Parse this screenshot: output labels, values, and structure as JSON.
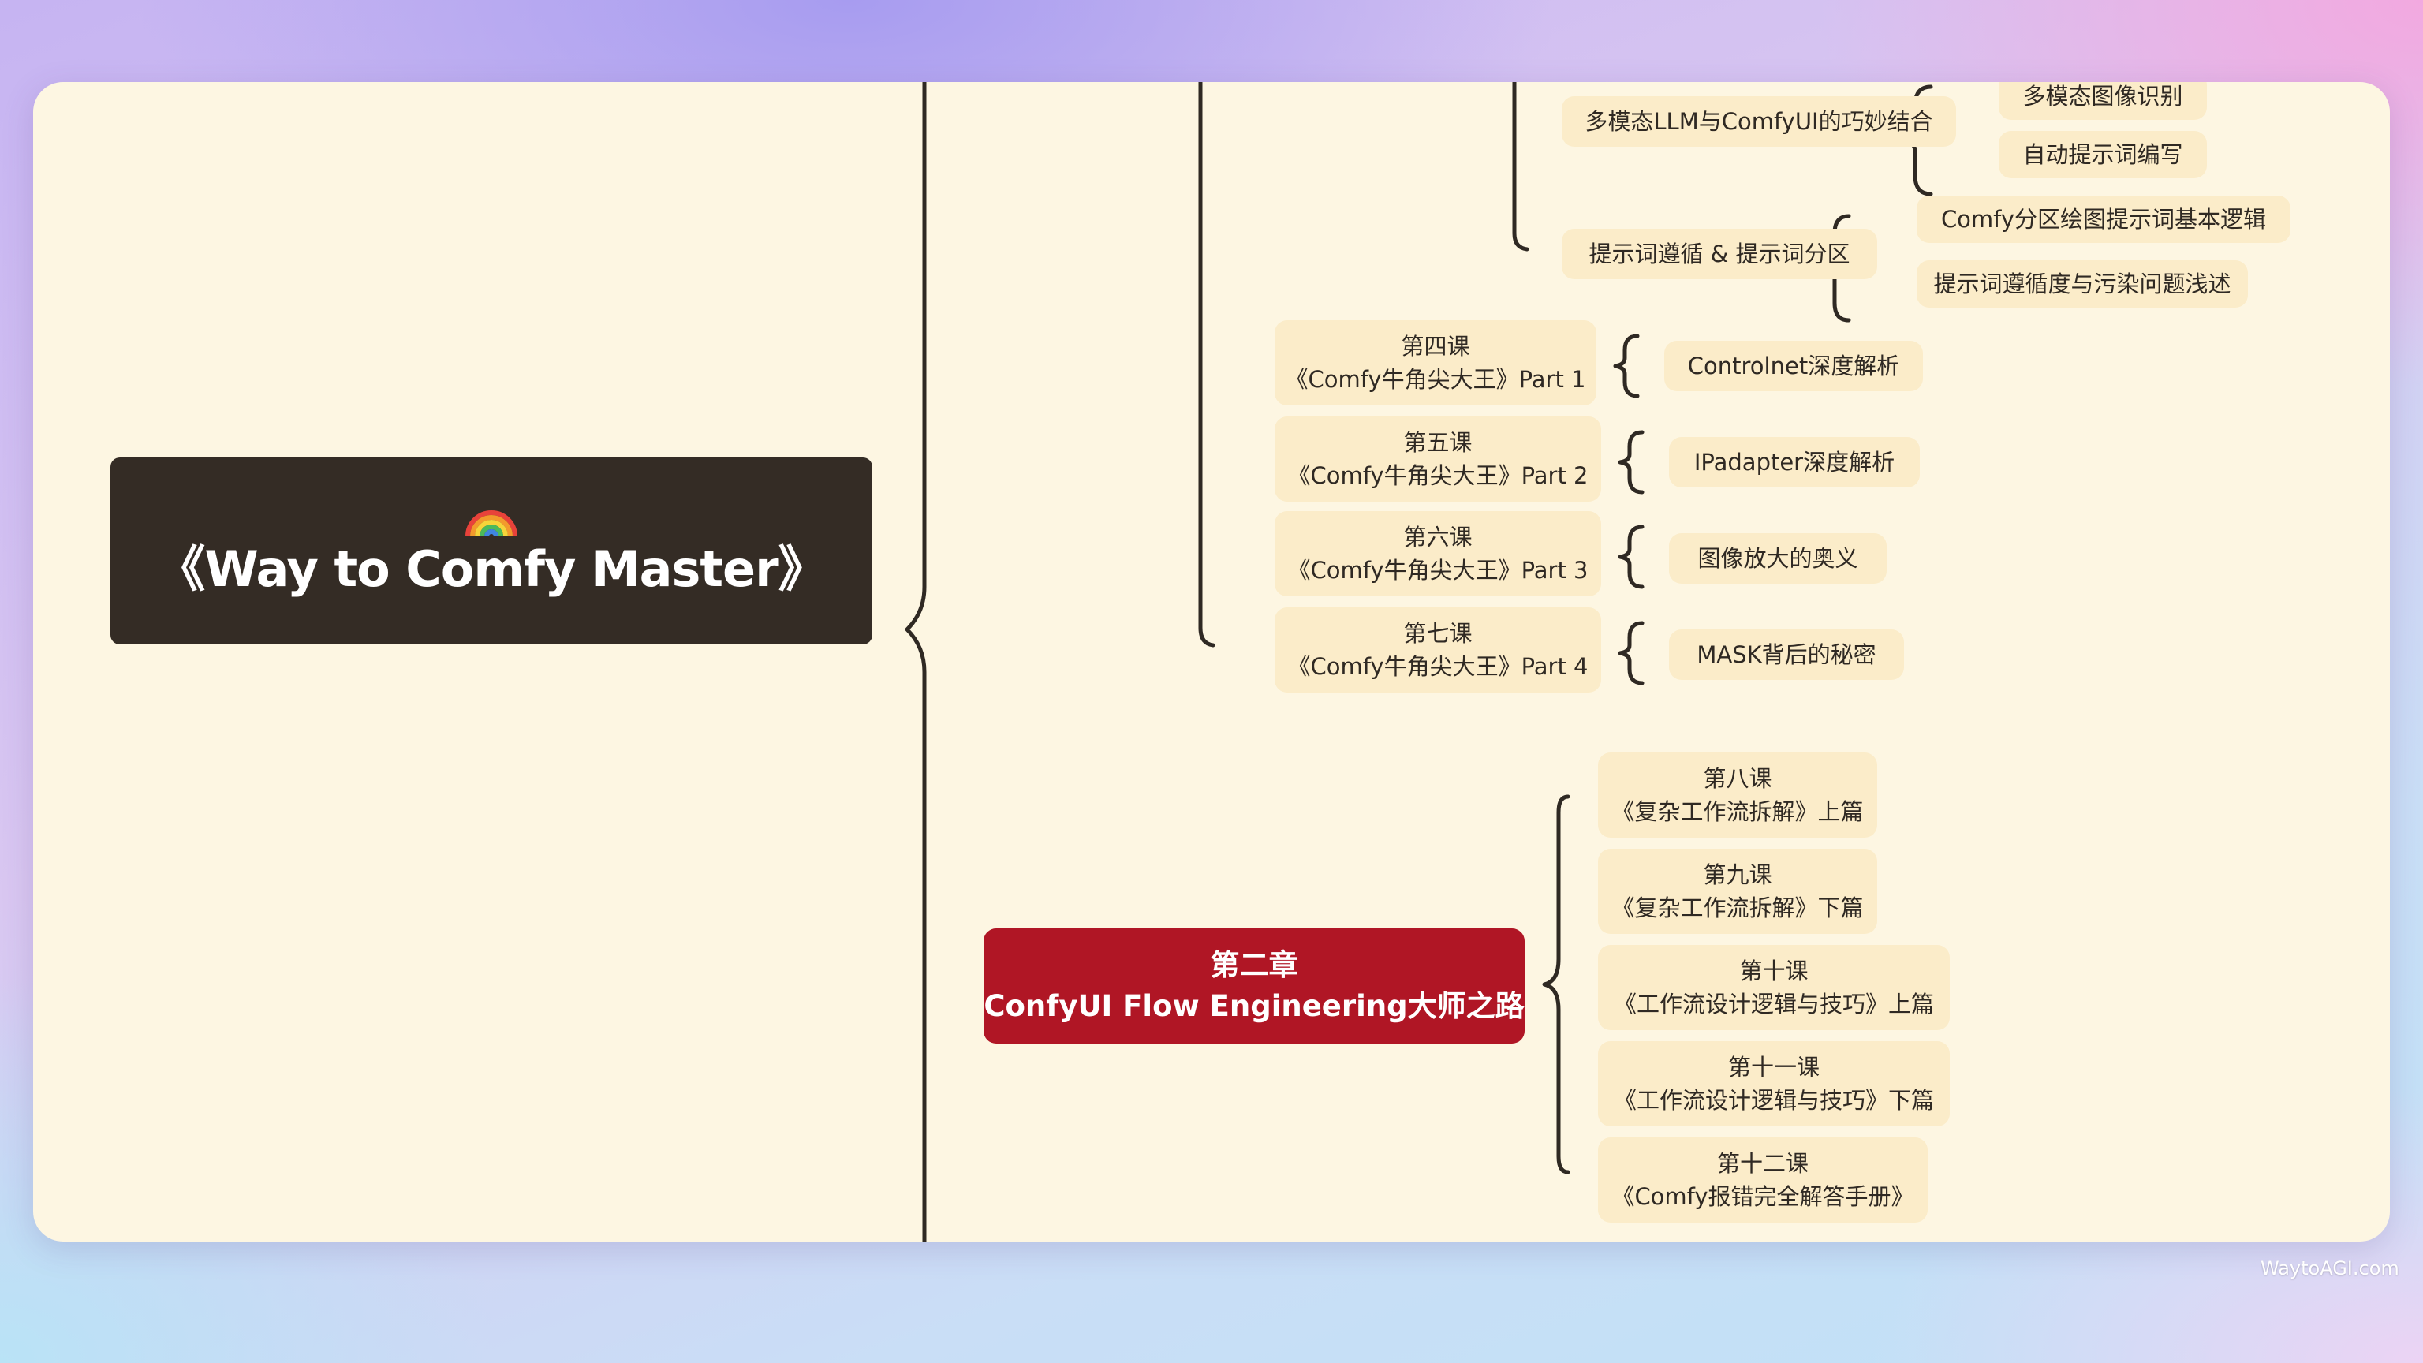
{
  "root": {
    "icon": "rainbow-icon",
    "title": "《Way to Comfy Master》"
  },
  "sub_topics": [
    {
      "label": "多模态LLM与ComfyUI的巧妙结合",
      "children": [
        "多模态图像识别",
        "自动提示词编写"
      ]
    },
    {
      "label": "提示词遵循 & 提示词分区",
      "children": [
        "Comfy分区绘图提示词基本逻辑",
        "提示词遵循度与污染问题浅述"
      ]
    }
  ],
  "lessons": [
    {
      "line1": "第四课",
      "line2": "《Comfy牛角尖大王》Part 1",
      "child": "Controlnet深度解析"
    },
    {
      "line1": "第五课",
      "line2": "《Comfy牛角尖大王》Part 2",
      "child": "IPadapter深度解析"
    },
    {
      "line1": "第六课",
      "line2": "《Comfy牛角尖大王》Part 3",
      "child": "图像放大的奥义"
    },
    {
      "line1": "第七课",
      "line2": "《Comfy牛角尖大王》Part 4",
      "child": "MASK背后的秘密"
    }
  ],
  "chapter2": {
    "line1": "第二章",
    "line2": "ConfyUI Flow Engineering大师之路",
    "lessons": [
      {
        "line1": "第八课",
        "line2": "《复杂工作流拆解》上篇"
      },
      {
        "line1": "第九课",
        "line2": "《复杂工作流拆解》下篇"
      },
      {
        "line1": "第十课",
        "line2": "《工作流设计逻辑与技巧》上篇"
      },
      {
        "line1": "第十一课",
        "line2": "《工作流设计逻辑与技巧》下篇"
      },
      {
        "line1": "第十二课",
        "line2": "《Comfy报错完全解答手册》"
      }
    ]
  },
  "colors": {
    "card_bg": "#fdf6e2",
    "node_bg": "#fbecc9",
    "root_bg": "#342c25",
    "chapter_bg": "#b01625",
    "line": "#2f2923"
  },
  "watermark": "WaytoAGI.com"
}
